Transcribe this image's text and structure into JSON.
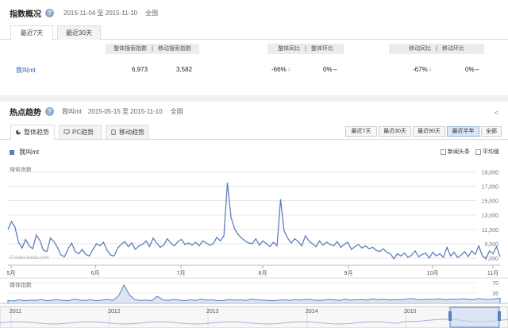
{
  "overview": {
    "title": "指数概况",
    "range": "2015-11-04 至 2015-11-10",
    "region": "全国",
    "tabs": [
      "最近7天",
      "最近30天"
    ],
    "headers": {
      "overall_search": "整体搜索指数",
      "sep1": "|",
      "mobile_search": "移动搜索指数",
      "overall_yoy": "整体同比",
      "sep2": "|",
      "overall_mom": "整体环比",
      "mobile_yoy": "移动同比",
      "sep3": "|",
      "mobile_mom": "移动环比"
    },
    "row": {
      "keyword": "我叫mt",
      "overall_search": "6,973",
      "mobile_search": "3,582",
      "overall_yoy": "-66%",
      "overall_mom": "0%",
      "mobile_yoy": "-67%",
      "mobile_mom": "0%",
      "dash": "–"
    }
  },
  "trend": {
    "title": "热点趋势",
    "keyword": "我叫mt",
    "range": "2015-05-15 至 2015-11-10",
    "region": "全国",
    "tabs": [
      "整体趋势",
      "PC趋势",
      "移动趋势"
    ],
    "range_buttons": [
      "最近7天",
      "最近30天",
      "最近90天",
      "最近半年",
      "全部"
    ],
    "active_range": "最近半年",
    "legend": "我叫mt",
    "toggles": [
      "新闻头条",
      "平均值"
    ],
    "search_axis_label": "搜索指数",
    "media_axis_label": "媒体指数",
    "watermark": "© index.baidu.com",
    "share_icon": "share-icon"
  },
  "colors": {
    "line": "#5b7fbd",
    "fill": "#dbe5f4",
    "accent": "#3ab03a",
    "gap": "#f0f0f0"
  },
  "chart_data": {
    "type": "line",
    "title": "",
    "ylabel": "搜索指数",
    "yticks": [
      "19,000",
      "17,000",
      "15,000",
      "13,000",
      "11,000",
      "9,000",
      "7,000"
    ],
    "ylim": [
      6000,
      19500
    ],
    "xticks": [
      "5月",
      "6月",
      "7月",
      "8月",
      "9月",
      "10月",
      "11月"
    ],
    "xlim": [
      "2015-05-15",
      "2015-11-10"
    ],
    "series": [
      {
        "name": "我叫mt",
        "values": [
          11000,
          12100,
          11300,
          9200,
          8400,
          9600,
          8700,
          8300,
          10200,
          9500,
          8100,
          7900,
          9800,
          9300,
          8500,
          7400,
          7200,
          8300,
          9100,
          7900,
          7600,
          8200,
          7500,
          7300,
          8200,
          9000,
          8700,
          9200,
          8100,
          7400,
          7300,
          8400,
          8900,
          9300,
          8600,
          9100,
          8200,
          8700,
          8900,
          9400,
          8600,
          9800,
          9100,
          8500,
          8800,
          9700,
          9100,
          8700,
          9300,
          9600,
          8900,
          9100,
          8800,
          9200,
          8700,
          9400,
          9100,
          8800,
          9000,
          9900,
          9400,
          10100,
          17500,
          12700,
          11100,
          10300,
          9800,
          9400,
          9100,
          9000,
          9700,
          8800,
          9400,
          9000,
          8600,
          9200,
          8700,
          15200,
          10800,
          9800,
          9100,
          9700,
          9300,
          8700,
          10100,
          9400,
          9000,
          8600,
          9400,
          8800,
          9200,
          8900,
          8700,
          9300,
          8500,
          8900,
          9200,
          8200,
          8600,
          8900,
          8400,
          8700,
          8300,
          8500,
          8100,
          7900,
          8300,
          7800,
          7600,
          6900,
          7600,
          7300,
          7700,
          7100,
          7400,
          8000,
          7200,
          7500,
          7700,
          7000,
          7800,
          7300,
          7600,
          7100,
          8500,
          7300,
          7800,
          7100,
          7400,
          7900,
          7200,
          8000,
          7500,
          8700,
          7300,
          6900,
          8000,
          7600,
          8600,
          7200
        ]
      }
    ],
    "media_series": {
      "name": "媒体指数",
      "yticks": [
        "70",
        "35"
      ],
      "ylim": [
        0,
        80
      ],
      "values": [
        10,
        8,
        12,
        9,
        11,
        10,
        13,
        9,
        11,
        12,
        10,
        9,
        14,
        11,
        10,
        12,
        9,
        11,
        13,
        10,
        25,
        62,
        28,
        12,
        10,
        11,
        9,
        24,
        12,
        10,
        13,
        11,
        9,
        12,
        10,
        14,
        11,
        12,
        9,
        10,
        13,
        11,
        12,
        10,
        14,
        12,
        11,
        10,
        9,
        11,
        12,
        10,
        13,
        11,
        14,
        12,
        10,
        11,
        13,
        12,
        10,
        14,
        11,
        12,
        13,
        11,
        15,
        12,
        14,
        11,
        13,
        12,
        14,
        16,
        13,
        12,
        14,
        13,
        15,
        12,
        14,
        13,
        15,
        14,
        12,
        16,
        14,
        13,
        15,
        17
      ]
    },
    "overview_axis": [
      "2011",
      "2012",
      "2013",
      "2014",
      "2015"
    ]
  }
}
